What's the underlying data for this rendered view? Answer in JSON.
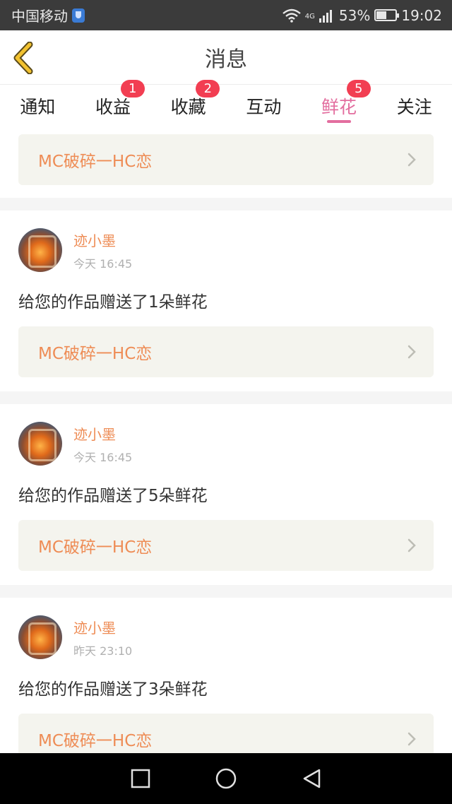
{
  "status_bar": {
    "carrier": "中国移动",
    "battery_percent": "53%",
    "battery_level": 0.53,
    "time": "19:02",
    "network_label": "4G"
  },
  "header": {
    "title": "消息"
  },
  "tabs": [
    {
      "label": "通知",
      "badge": ""
    },
    {
      "label": "收益",
      "badge": "1"
    },
    {
      "label": "收藏",
      "badge": "2"
    },
    {
      "label": "互动",
      "badge": ""
    },
    {
      "label": "鲜花",
      "badge": "5"
    },
    {
      "label": "关注",
      "badge": ""
    }
  ],
  "active_tab": "鲜花",
  "messages": [
    {
      "work_title": "MC破碎一HC恋"
    },
    {
      "user": "迹小墨",
      "time": "今天 16:45",
      "text": "给您的作品赠送了1朵鲜花",
      "work_title": "MC破碎一HC恋"
    },
    {
      "user": "迹小墨",
      "time": "今天 16:45",
      "text": "给您的作品赠送了5朵鲜花",
      "work_title": "MC破碎一HC恋"
    },
    {
      "user": "迹小墨",
      "time": "昨天 23:10",
      "text": "给您的作品赠送了3朵鲜花",
      "work_title": "MC破碎一HC恋"
    }
  ],
  "colors": {
    "accent_pink": "#e36e9f",
    "badge_red": "#f23e52",
    "orange_text": "#ee8c55",
    "back_yellow": "#f2c230"
  }
}
